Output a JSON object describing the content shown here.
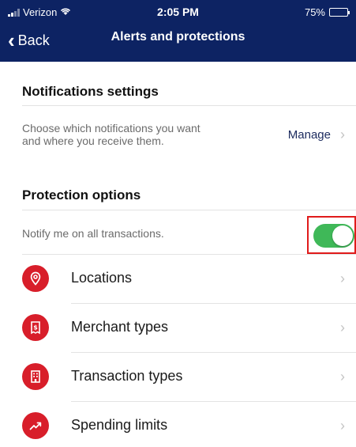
{
  "status_bar": {
    "carrier": "Verizon",
    "time": "2:05 PM",
    "battery": "75%",
    "battery_level": 0.75
  },
  "nav": {
    "back_label": "Back",
    "title": "Alerts and protections"
  },
  "notifications": {
    "title": "Notifications settings",
    "description_line1": "Choose which notifications you want",
    "description_line2": "and where you receive them.",
    "manage_label": "Manage"
  },
  "protection": {
    "title": "Protection options",
    "notify_text": "Notify me on all transactions.",
    "notify_enabled": true,
    "items": [
      {
        "label": "Locations",
        "icon": "location-pin-icon"
      },
      {
        "label": "Merchant types",
        "icon": "receipt-icon"
      },
      {
        "label": "Transaction types",
        "icon": "building-icon"
      },
      {
        "label": "Spending limits",
        "icon": "trend-up-icon"
      }
    ]
  },
  "colors": {
    "header_bg": "#0d2363",
    "accent_red": "#d81e2a",
    "toggle_on": "#3fb858",
    "highlight_border": "#e01b1b"
  }
}
